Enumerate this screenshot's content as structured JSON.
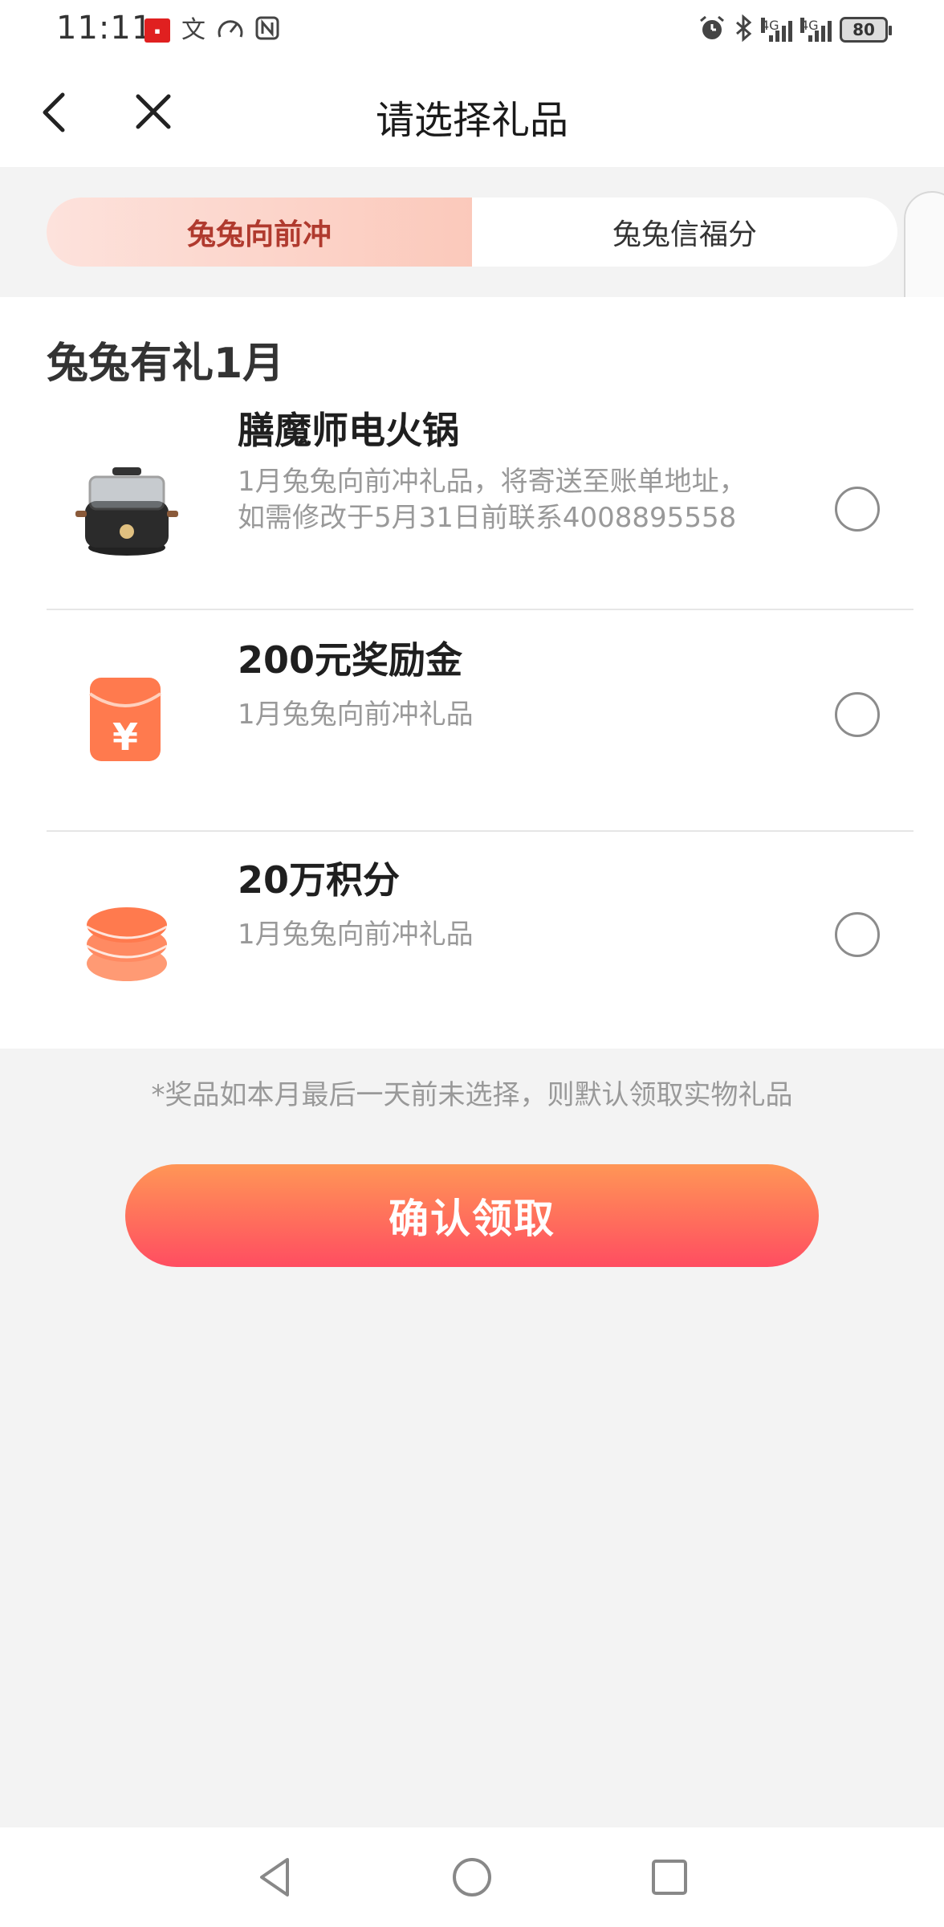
{
  "status_bar": {
    "time": "11:11",
    "left_icons": [
      "app-badge-icon",
      "translate-icon",
      "speedometer-icon",
      "nfc-icon"
    ],
    "right_icons": [
      "alarm-icon",
      "bluetooth-icon",
      "signal-4g-icon",
      "signal-4g-icon"
    ],
    "network_label_1": "4G",
    "network_label_2": "4G",
    "battery": "80"
  },
  "nav": {
    "title": "请选择礼品",
    "back_icon": "chevron-left-icon",
    "close_icon": "close-icon"
  },
  "tabs": [
    {
      "label": "兔兔向前冲",
      "active": true
    },
    {
      "label": "兔兔信福分",
      "active": false
    }
  ],
  "section": {
    "title": "兔兔有礼1月"
  },
  "gifts": [
    {
      "name": "膳魔师电火锅",
      "desc": "1月兔兔向前冲礼品，将寄送至账单地址，如需修改于5月31日前联系4008895558",
      "icon": "hotpot-image",
      "selected": false
    },
    {
      "name": "200元奖励金",
      "desc": "1月兔兔向前冲礼品",
      "icon": "red-envelope-icon",
      "selected": false
    },
    {
      "name": "20万积分",
      "desc": "1月兔兔向前冲礼品",
      "icon": "coin-stack-icon",
      "selected": false
    }
  ],
  "notice": "*奖品如本月最后一天前未选择，则默认领取实物礼品",
  "confirm_label": "确认领取",
  "colors": {
    "accent_start": "#ff9656",
    "accent_end": "#ff4d61",
    "active_tab_text": "#b03a2e",
    "icon_orange": "#ff7a4e"
  }
}
